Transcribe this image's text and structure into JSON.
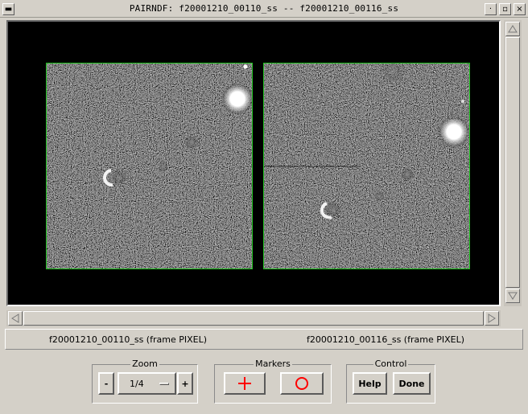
{
  "window": {
    "title": "PAIRNDF: f20001210_00110_ss -- f20001210_00116_ss"
  },
  "frames": {
    "left_label": "f20001210_00110_ss (frame PIXEL)",
    "right_label": "f20001210_00116_ss (frame PIXEL)",
    "border_color": "#22c322"
  },
  "zoom": {
    "title": "Zoom",
    "decrease_label": "-",
    "value": "1/4",
    "increase_label": "+"
  },
  "markers": {
    "title": "Markers",
    "cross_icon": "cross-marker-icon",
    "circle_icon": "circle-marker-icon",
    "marker_color": "#ff0000"
  },
  "control": {
    "title": "Control",
    "help_label": "Help",
    "done_label": "Done"
  },
  "scrollbars": {
    "up_icon": "arrow-up-icon",
    "down_icon": "arrow-down-icon",
    "left_icon": "arrow-left-icon",
    "right_icon": "arrow-right-icon"
  }
}
